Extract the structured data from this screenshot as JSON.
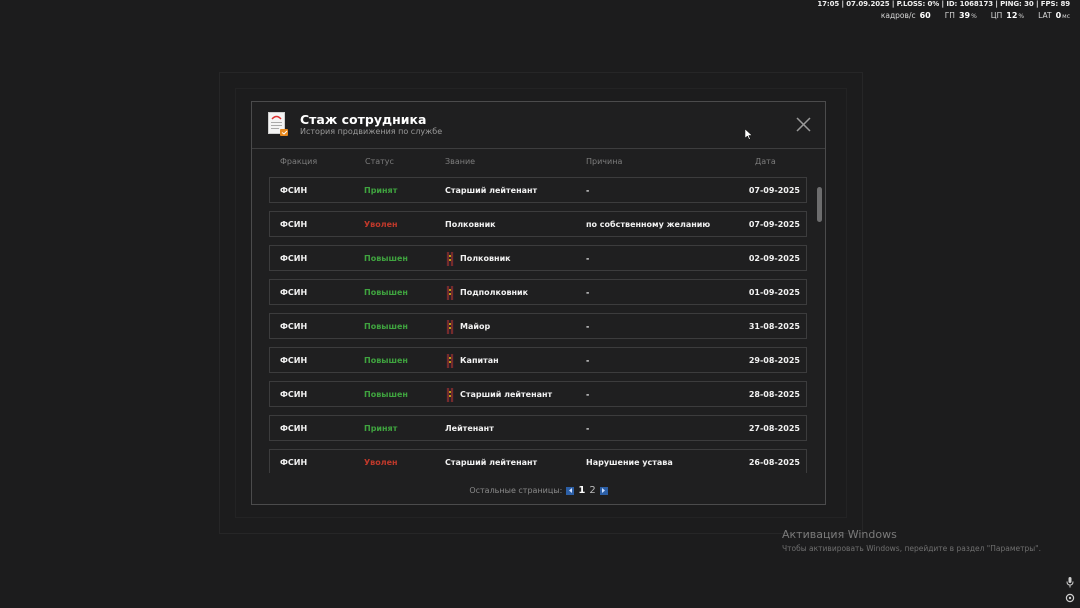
{
  "hud": {
    "topline": "17:05 | 07.09.2025 | P.LOSS: 0% | ID: 1068173 | PING: 30 | FPS: 89",
    "fps_label": "кадров/с",
    "fps_value": "60",
    "gpu_label": "ГП",
    "gpu_value": "39",
    "cpu_label": "ЦП",
    "cpu_value": "12",
    "lat_label": "LAT",
    "lat_value": "0",
    "percent_unit": "%",
    "ms_unit": "мс"
  },
  "modal": {
    "title": "Стаж сотрудника",
    "subtitle": "История продвижения по службе",
    "close_icon": "close-icon",
    "document_icon": "document-icon"
  },
  "columns": {
    "faction": "Фракция",
    "status": "Статус",
    "rank": "Звание",
    "reason": "Причина",
    "date": "Дата"
  },
  "status_colors": {
    "Принят": "#3fa33f",
    "Уволен": "#c0392b",
    "Повышен": "#3fa33f"
  },
  "rows": [
    {
      "faction": "ФСИН",
      "status": "Принят",
      "rank": "Старший лейтенант",
      "reason": "-",
      "date": "07-09-2025",
      "rank_icon": false
    },
    {
      "faction": "ФСИН",
      "status": "Уволен",
      "rank": "Полковник",
      "reason": "по собственному желанию",
      "date": "07-09-2025",
      "rank_icon": false
    },
    {
      "faction": "ФСИН",
      "status": "Повышен",
      "rank": "Полковник",
      "reason": "-",
      "date": "02-09-2025",
      "rank_icon": true
    },
    {
      "faction": "ФСИН",
      "status": "Повышен",
      "rank": "Подполковник",
      "reason": "-",
      "date": "01-09-2025",
      "rank_icon": true
    },
    {
      "faction": "ФСИН",
      "status": "Повышен",
      "rank": "Майор",
      "reason": "-",
      "date": "31-08-2025",
      "rank_icon": true
    },
    {
      "faction": "ФСИН",
      "status": "Повышен",
      "rank": "Капитан",
      "reason": "-",
      "date": "29-08-2025",
      "rank_icon": true
    },
    {
      "faction": "ФСИН",
      "status": "Повышен",
      "rank": "Старший лейтенант",
      "reason": "-",
      "date": "28-08-2025",
      "rank_icon": true
    },
    {
      "faction": "ФСИН",
      "status": "Принят",
      "rank": "Лейтенант",
      "reason": "-",
      "date": "27-08-2025",
      "rank_icon": false
    },
    {
      "faction": "ФСИН",
      "status": "Уволен",
      "rank": "Старший лейтенант",
      "reason": "Нарушение устава",
      "date": "26-08-2025",
      "rank_icon": false
    }
  ],
  "pagination": {
    "label": "Остальные страницы:",
    "pages": [
      "1",
      "2"
    ],
    "current": "1"
  },
  "windows_activation": {
    "title": "Активация Windows",
    "text": "Чтобы активировать Windows, перейдите в раздел \"Параметры\"."
  }
}
